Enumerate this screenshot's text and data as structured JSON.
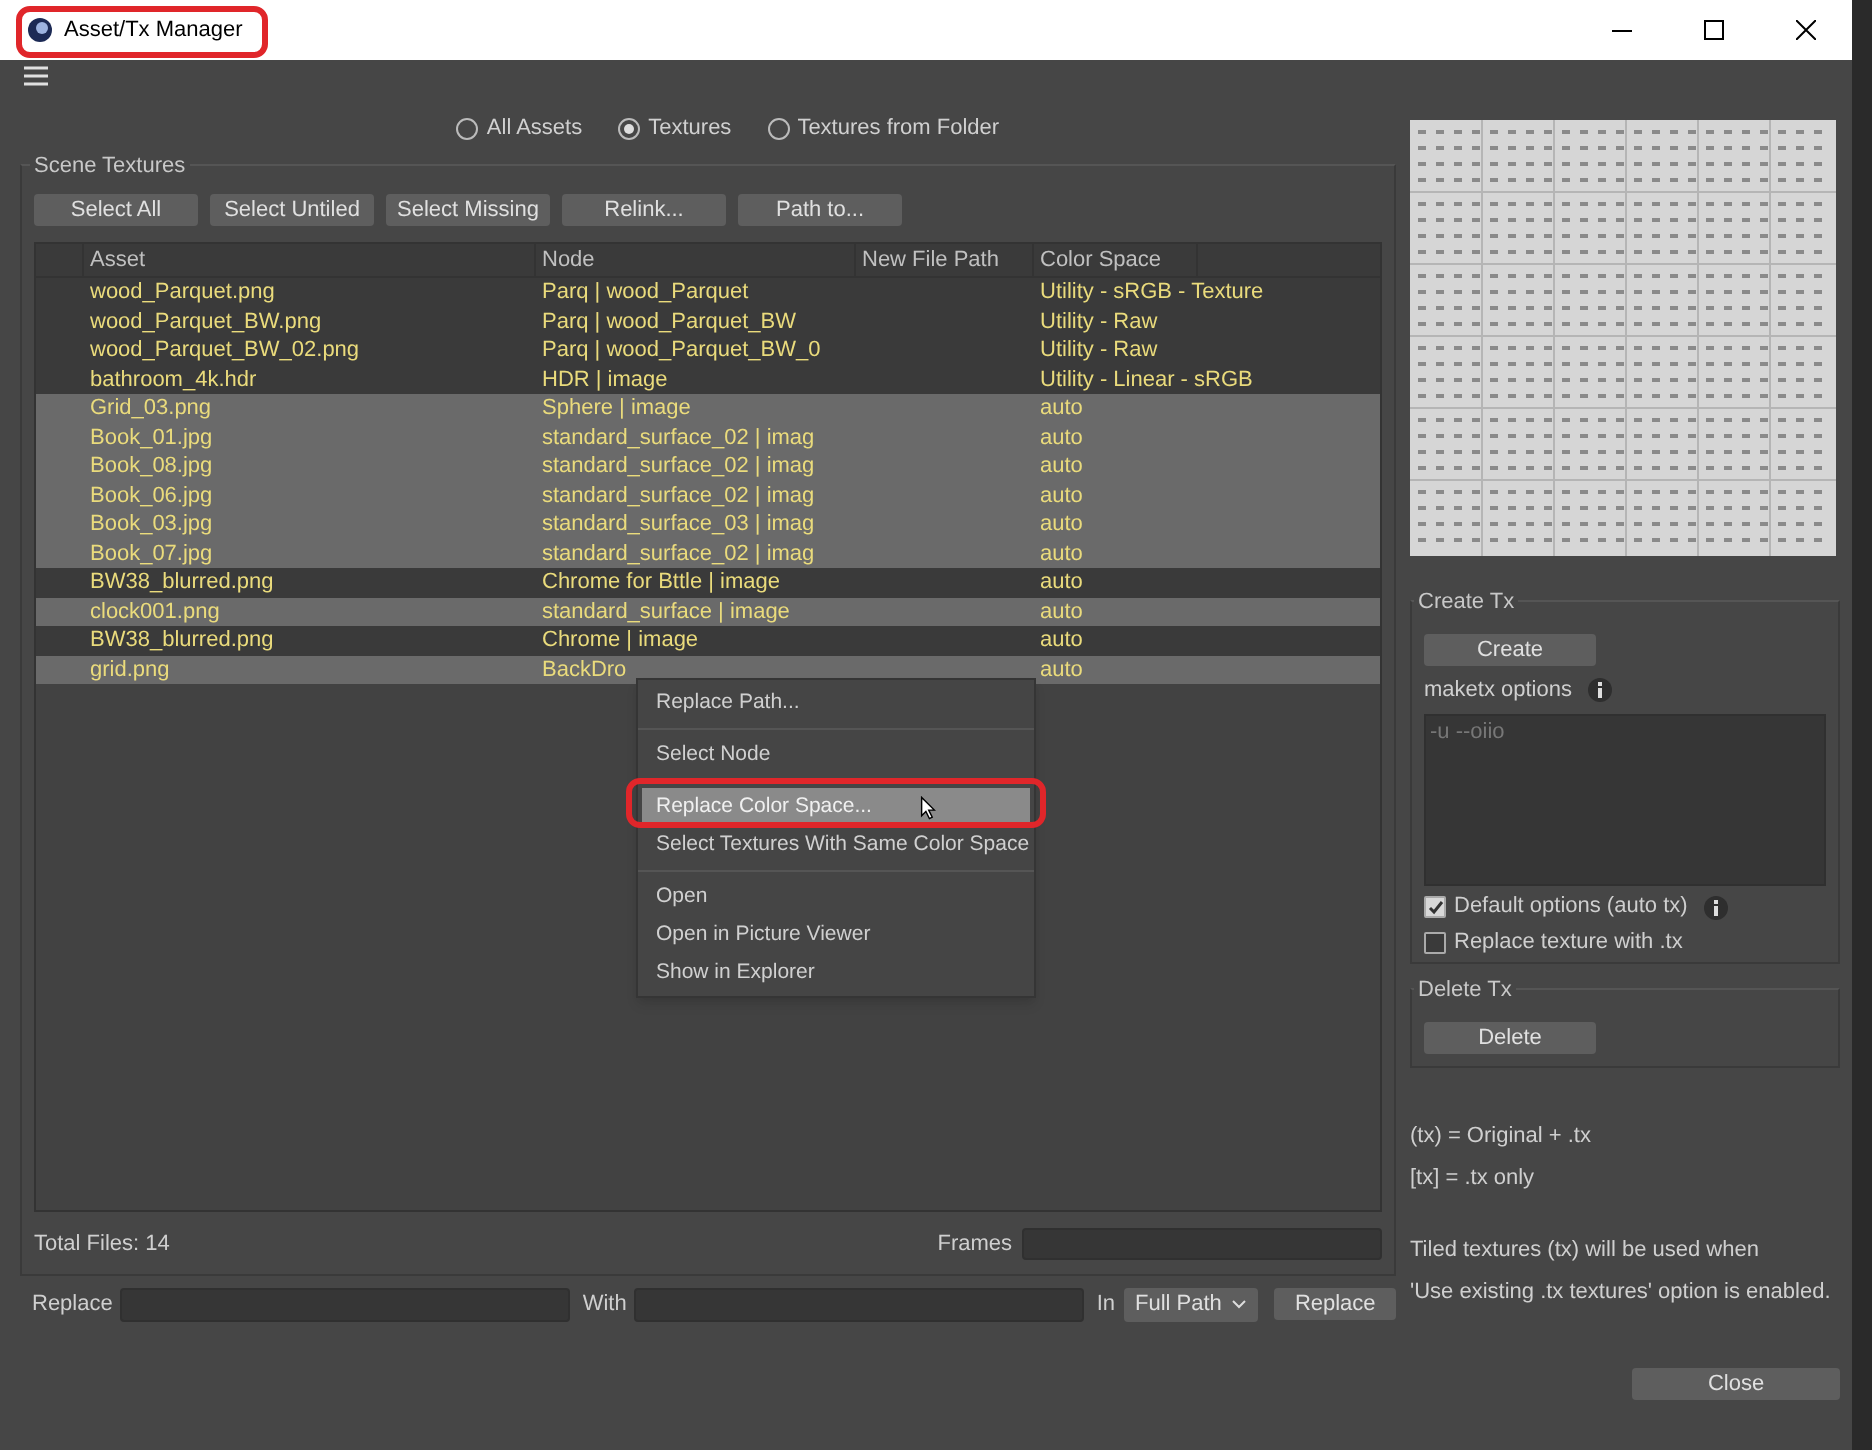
{
  "window": {
    "title": "Asset/Tx Manager"
  },
  "view_options": [
    {
      "label": "All Assets",
      "selected": false
    },
    {
      "label": "Textures",
      "selected": true
    },
    {
      "label": "Textures from Folder",
      "selected": false
    }
  ],
  "scene_textures": {
    "title": "Scene Textures",
    "buttons": [
      "Select All",
      "Select Untiled",
      "Select Missing",
      "Relink...",
      "Path to..."
    ],
    "columns": [
      "Asset",
      "Node",
      "New File Path",
      "Color Space"
    ],
    "rows": [
      {
        "asset": "wood_Parquet.png",
        "node": "Parq | wood_Parquet",
        "color_space": "Utility - sRGB - Texture",
        "selected": false
      },
      {
        "asset": "wood_Parquet_BW.png",
        "node": "Parq | wood_Parquet_BW",
        "color_space": "Utility - Raw",
        "selected": false
      },
      {
        "asset": "wood_Parquet_BW_02.png",
        "node": "Parq | wood_Parquet_BW_0",
        "color_space": "Utility - Raw",
        "selected": false
      },
      {
        "asset": "bathroom_4k.hdr",
        "node": "HDR | image",
        "color_space": "Utility - Linear - sRGB",
        "selected": false
      },
      {
        "asset": "Grid_03.png",
        "node": "Sphere | image",
        "color_space": "auto",
        "selected": true
      },
      {
        "asset": "Book_01.jpg",
        "node": "standard_surface_02 | imag",
        "color_space": "auto",
        "selected": true
      },
      {
        "asset": "Book_08.jpg",
        "node": "standard_surface_02 | imag",
        "color_space": "auto",
        "selected": true
      },
      {
        "asset": "Book_06.jpg",
        "node": "standard_surface_02 | imag",
        "color_space": "auto",
        "selected": true
      },
      {
        "asset": "Book_03.jpg",
        "node": "standard_surface_03 | imag",
        "color_space": "auto",
        "selected": true
      },
      {
        "asset": "Book_07.jpg",
        "node": "standard_surface_02 | imag",
        "color_space": "auto",
        "selected": true
      },
      {
        "asset": "BW38_blurred.png",
        "node": "Chrome for Bttle | image",
        "color_space": "auto",
        "selected": false
      },
      {
        "asset": "clock001.png",
        "node": "standard_surface | image",
        "color_space": "auto",
        "selected": true
      },
      {
        "asset": "BW38_blurred.png",
        "node": "Chrome | image",
        "color_space": "auto",
        "selected": false
      },
      {
        "asset": "grid.png",
        "node": "BackDro",
        "color_space": "auto",
        "selected": true
      }
    ]
  },
  "context_menu": {
    "sections": [
      [
        {
          "label": "Replace Path...",
          "selected": false
        }
      ],
      [
        {
          "label": "Select Node",
          "selected": false
        }
      ],
      [
        {
          "label": "Replace Color Space...",
          "selected": true
        },
        {
          "label": "Select Textures With Same Color Space",
          "selected": false
        }
      ],
      [
        {
          "label": "Open",
          "selected": false
        },
        {
          "label": "Open in Picture Viewer",
          "selected": false
        },
        {
          "label": "Show in Explorer",
          "selected": false
        }
      ]
    ]
  },
  "total_files": "Total Files: 14",
  "frames": {
    "label": "Frames"
  },
  "replace_bar": {
    "replace_label": "Replace",
    "with_label": "With",
    "in_label": "In",
    "in_value": "Full Path",
    "button": "Replace"
  },
  "create_tx": {
    "title": "Create Tx",
    "button": "Create",
    "options_label": "maketx options",
    "options_placeholder": "-u --oiio",
    "checkboxes": [
      {
        "label": "Default options (auto tx)",
        "checked": true,
        "info": true
      },
      {
        "label": "Replace texture with .tx",
        "checked": false,
        "info": false
      }
    ]
  },
  "delete_tx": {
    "title": "Delete Tx",
    "button": "Delete"
  },
  "legend": [
    "(tx) = Original + .tx",
    "[tx] = .tx only"
  ],
  "tiled_note": [
    "Tiled textures (tx) will be used when",
    "'Use existing .tx textures' option is enabled."
  ],
  "close_button": "Close"
}
